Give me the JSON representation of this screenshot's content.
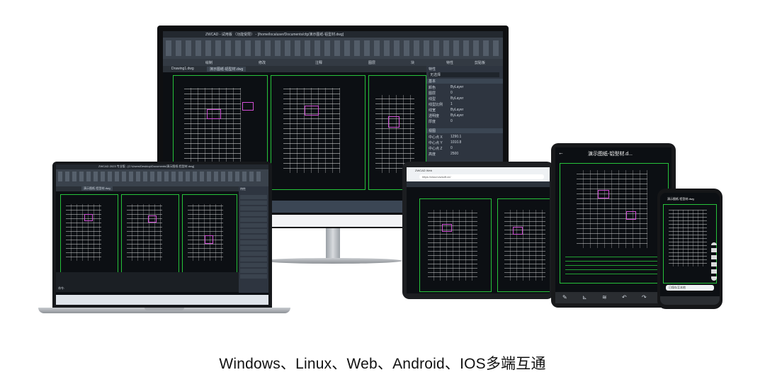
{
  "caption": "Windows、Linux、Web、Android、IOS多端互通",
  "monitor": {
    "window_title": "ZWCAD - 试用版 （功能受限） - [/home/localuser/Documents/cfg/演示图纸-铝型材.dwg]",
    "tabs": [
      "Drawing1.dwg",
      "演示图纸-铝型材.dwg"
    ],
    "panel_title": "特性",
    "panel_subtitle": "无选择",
    "panel_sections": [
      "基本",
      "视图"
    ],
    "props": [
      {
        "k": "颜色",
        "v": "ByLayer"
      },
      {
        "k": "图层",
        "v": "0"
      },
      {
        "k": "线型",
        "v": "ByLayer"
      },
      {
        "k": "线型比例",
        "v": "1"
      },
      {
        "k": "线宽",
        "v": "ByLayer"
      },
      {
        "k": "透明度",
        "v": "ByLayer"
      },
      {
        "k": "厚度",
        "v": "0"
      }
    ],
    "view_props": [
      {
        "k": "中心点 X",
        "v": "1290.1"
      },
      {
        "k": "中心点 Y",
        "v": "1010.8"
      },
      {
        "k": "中心点 Z",
        "v": "0"
      },
      {
        "k": "高度",
        "v": "2500"
      }
    ],
    "ribbon_groups": [
      "绘制",
      "修改",
      "注释",
      "图层",
      "块",
      "特性",
      "剪贴板"
    ]
  },
  "laptop": {
    "window_title": "ZWCAD 2023 专业版 - [C:\\Users\\Desktop\\Documents\\演示图纸-铝型材.dwg]",
    "tab": "演示图纸-铝型材.dwg",
    "panel_title": "特性",
    "cmd_line": "命令:"
  },
  "tablet": {
    "tab_title": "ZWCAD Web",
    "url": "https://cloud.zwsoft.cn/"
  },
  "pad": {
    "title": "演示图纸-铝型材.d..."
  },
  "phone": {
    "title": "演示图纸-铝型材.dwg",
    "toast": "已保存至本地"
  },
  "colors": {
    "line_green": "#26c23a",
    "ui_dark": "#2b323b",
    "canvas": "#0c0f13",
    "magenta": "#d14fd6",
    "cyan": "#37c9e8"
  }
}
